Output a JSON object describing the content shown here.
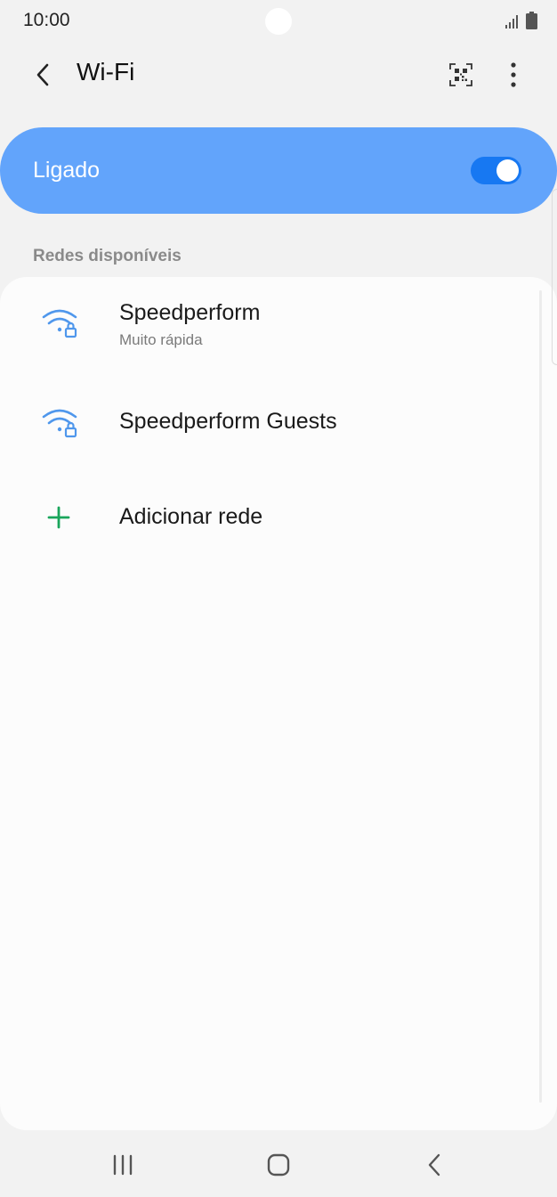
{
  "status_bar": {
    "time": "10:00",
    "signal_icon": "signal-bars-icon",
    "battery_icon": "battery-icon"
  },
  "app_bar": {
    "title": "Wi-Fi",
    "back_icon": "chevron-left-icon",
    "qr_icon": "qr-code-icon",
    "more_icon": "more-vertical-icon"
  },
  "master_switch": {
    "label": "Ligado",
    "state": "on"
  },
  "section_header": "Redes disponíveis",
  "networks": [
    {
      "name": "Speedperform",
      "subtitle": "Muito rápida",
      "icon": "wifi-lock-icon"
    },
    {
      "name": "Speedperform Guests",
      "icon": "wifi-lock-icon"
    }
  ],
  "add_network": {
    "label": "Adicionar rede",
    "icon": "plus-icon"
  },
  "nav_bar": {
    "recents_icon": "recents-icon",
    "home_icon": "home-icon",
    "back_icon": "back-icon"
  },
  "colors": {
    "accent": "#62a4fb",
    "toggle_on": "#1778f2",
    "wifi_icon": "#4f97ec",
    "add_icon": "#19a55b",
    "background": "#f2f2f2",
    "card": "#fcfcfc"
  }
}
